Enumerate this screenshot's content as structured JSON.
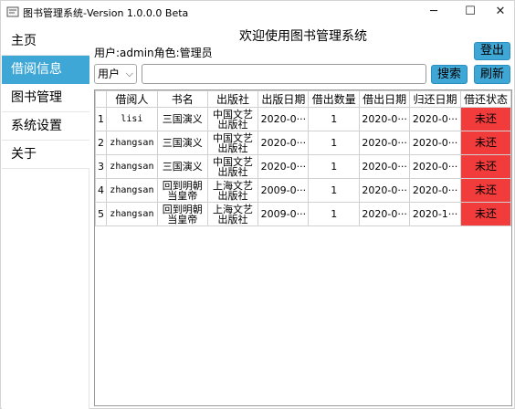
{
  "window": {
    "title": "图书管理系统-Version 1.0.0.0 Beta",
    "controls": {
      "minimize": "─",
      "maximize": "☐",
      "close": "✕"
    }
  },
  "sidebar": {
    "items": [
      {
        "label": "主页",
        "active": false
      },
      {
        "label": "借阅信息",
        "active": true
      },
      {
        "label": "图书管理",
        "active": false
      },
      {
        "label": "系统设置",
        "active": false
      },
      {
        "label": "关于",
        "active": false
      }
    ]
  },
  "header": {
    "welcome": "欢迎使用图书管理系统",
    "user_line": "用户:admin角色:管理员",
    "logout_label": "登出"
  },
  "search": {
    "field_selected": "用户",
    "query_value": "",
    "search_label": "搜索",
    "refresh_label": "刷新"
  },
  "table": {
    "columns": [
      "",
      "借阅人",
      "书名",
      "出版社",
      "出版日期",
      "借出数量",
      "借出日期",
      "归还日期",
      "借还状态"
    ],
    "rows": [
      [
        "1",
        "lisi",
        "三国演义",
        "中国文艺出版社",
        "2020-0···",
        "1",
        "2020-0···",
        "2020-0···",
        "未还"
      ],
      [
        "2",
        "zhangsan",
        "三国演义",
        "中国文艺出版社",
        "2020-0···",
        "1",
        "2020-0···",
        "2020-0···",
        "未还"
      ],
      [
        "3",
        "zhangsan",
        "三国演义",
        "中国文艺出版社",
        "2020-0···",
        "1",
        "2020-0···",
        "2020-0···",
        "未还"
      ],
      [
        "4",
        "zhangsan",
        "回到明朝当皇帝",
        "上海文艺出版社",
        "2009-0···",
        "1",
        "2020-0···",
        "2020-0···",
        "未还"
      ],
      [
        "5",
        "zhangsan",
        "回到明朝当皇帝",
        "上海文艺出版社",
        "2009-0···",
        "1",
        "2020-0···",
        "2020-1···",
        "未还"
      ]
    ]
  },
  "colors": {
    "accent": "#3fa7d6",
    "status_unreturned": "#f23c3c"
  }
}
